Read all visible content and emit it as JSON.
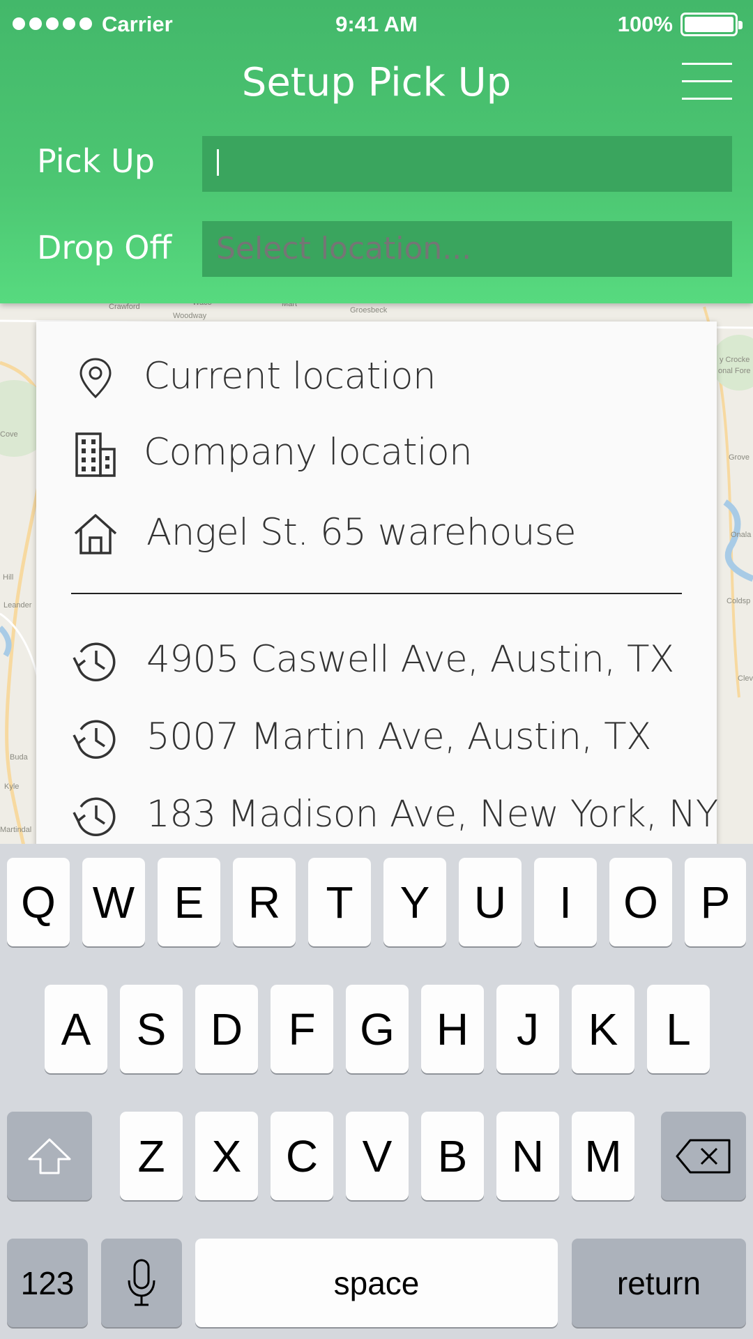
{
  "status_bar": {
    "carrier": "Carrier",
    "time": "9:41 AM",
    "battery": "100%"
  },
  "header": {
    "title": "Setup Pick Up",
    "menu_icon": "hamburger-menu-icon",
    "pickup_label": "Pick Up",
    "pickup_value": "",
    "dropoff_label": "Drop Off",
    "dropoff_placeholder": "Select location..."
  },
  "suggestions": {
    "saved": [
      {
        "icon": "map-pin-icon",
        "label": "Current location"
      },
      {
        "icon": "building-icon",
        "label": "Company location"
      },
      {
        "icon": "home-icon",
        "label": "Angel St. 65 warehouse"
      }
    ],
    "recent": [
      {
        "icon": "history-icon",
        "label": "4905 Caswell Ave, Austin, TX"
      },
      {
        "icon": "history-icon",
        "label": "5007 Martin Ave, Austin, TX"
      },
      {
        "icon": "history-icon",
        "label": "183 Madison Ave, New York, NY"
      }
    ]
  },
  "map_labels": [
    "Crawford",
    "Waco",
    "Woodway",
    "Mart",
    "Groesbeck",
    "Cove",
    "Grove",
    "Onala",
    "Hill",
    "Leander",
    "Coldsp",
    "Clev",
    "Buda",
    "Kyle",
    "Martindal",
    "y Crocke",
    "onal Fore"
  ],
  "keyboard": {
    "row1": [
      "Q",
      "W",
      "E",
      "R",
      "T",
      "Y",
      "U",
      "I",
      "O",
      "P"
    ],
    "row2": [
      "A",
      "S",
      "D",
      "F",
      "G",
      "H",
      "J",
      "K",
      "L"
    ],
    "row3": [
      "Z",
      "X",
      "C",
      "V",
      "B",
      "N",
      "M"
    ],
    "numbers_label": "123",
    "space_label": "space",
    "return_label": "return"
  },
  "colors": {
    "header_green": "#4cc672",
    "input_green": "#3aa55e",
    "keyboard_bg": "#d5d8dd"
  }
}
